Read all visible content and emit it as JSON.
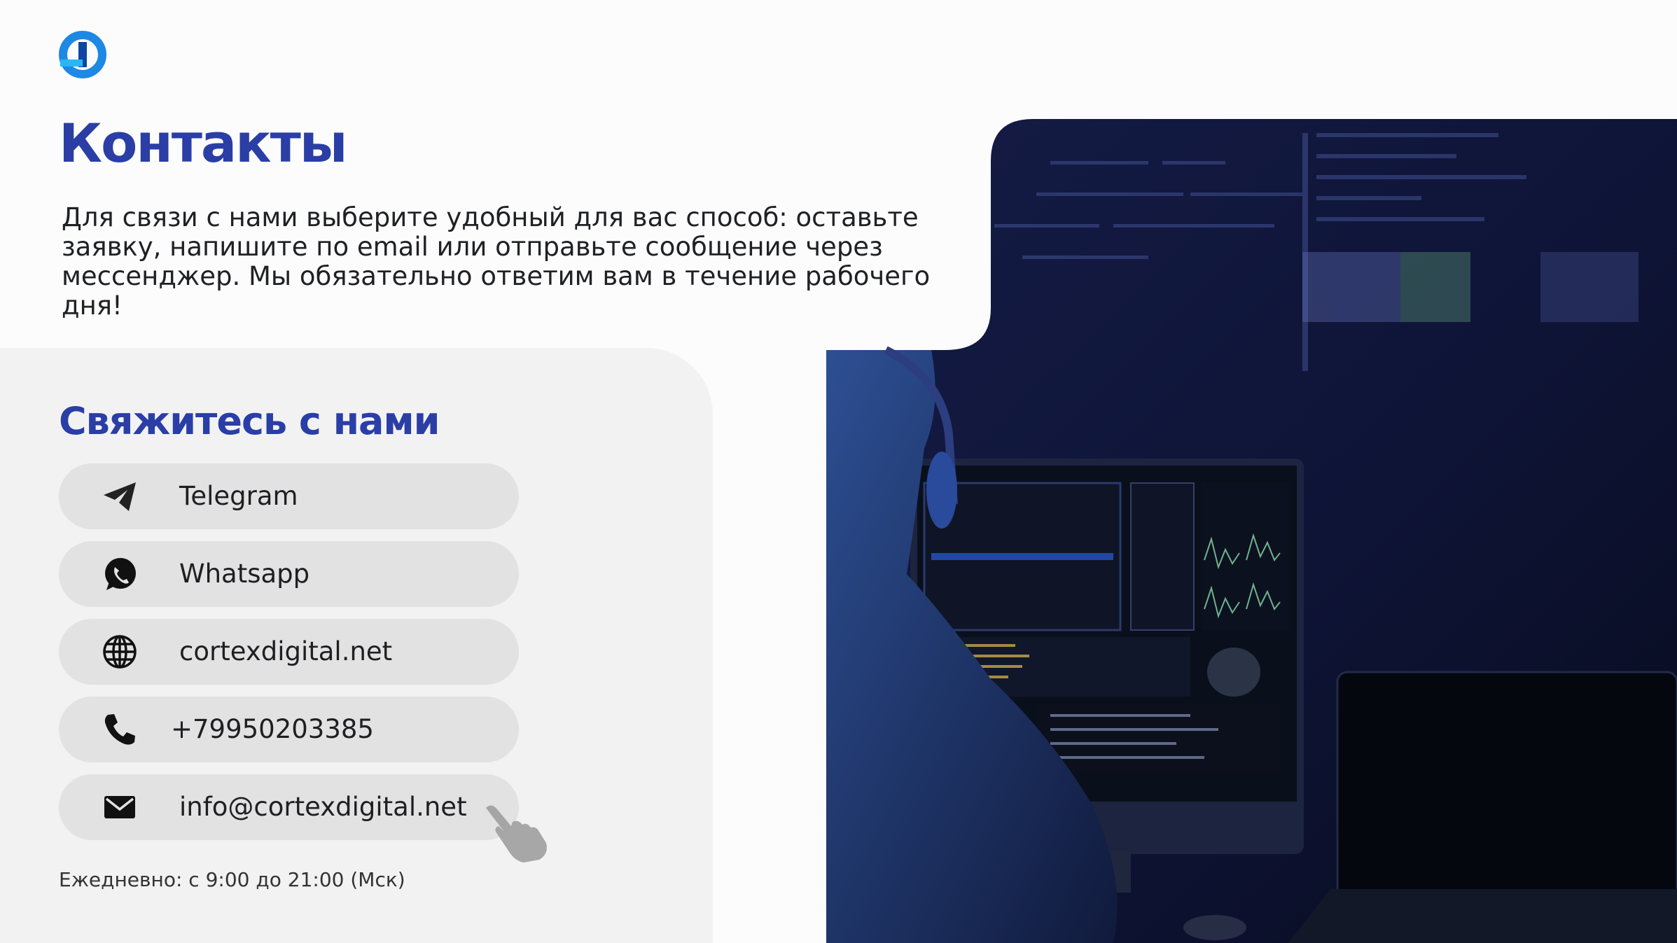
{
  "title": "Контакты",
  "intro": "Для связи с нами выберите удобный для вас способ: оставьте заявку, напишите по email или отправьте сообщение через мессенджер. Мы обязательно ответим вам в течение рабочего дня!",
  "contact_section": {
    "heading": "Свяжитесь с нами",
    "items": [
      {
        "icon": "telegram-icon",
        "label": "Telegram"
      },
      {
        "icon": "whatsapp-icon",
        "label": "Whatsapp"
      },
      {
        "icon": "globe-icon",
        "label": "cortexdigital.net"
      },
      {
        "icon": "phone-icon",
        "label": "+79950203385"
      },
      {
        "icon": "mail-icon",
        "label": "info@cortexdigital.net"
      }
    ],
    "hours": "Ежедневно: с 9:00 до 21:00 (Мск)"
  },
  "colors": {
    "brand": "#2a3ea6",
    "logo_blue": "#1e88e5",
    "pill": "#e2e2e3",
    "panel": "#f2f2f3",
    "photo_dark": "#0d1330"
  }
}
